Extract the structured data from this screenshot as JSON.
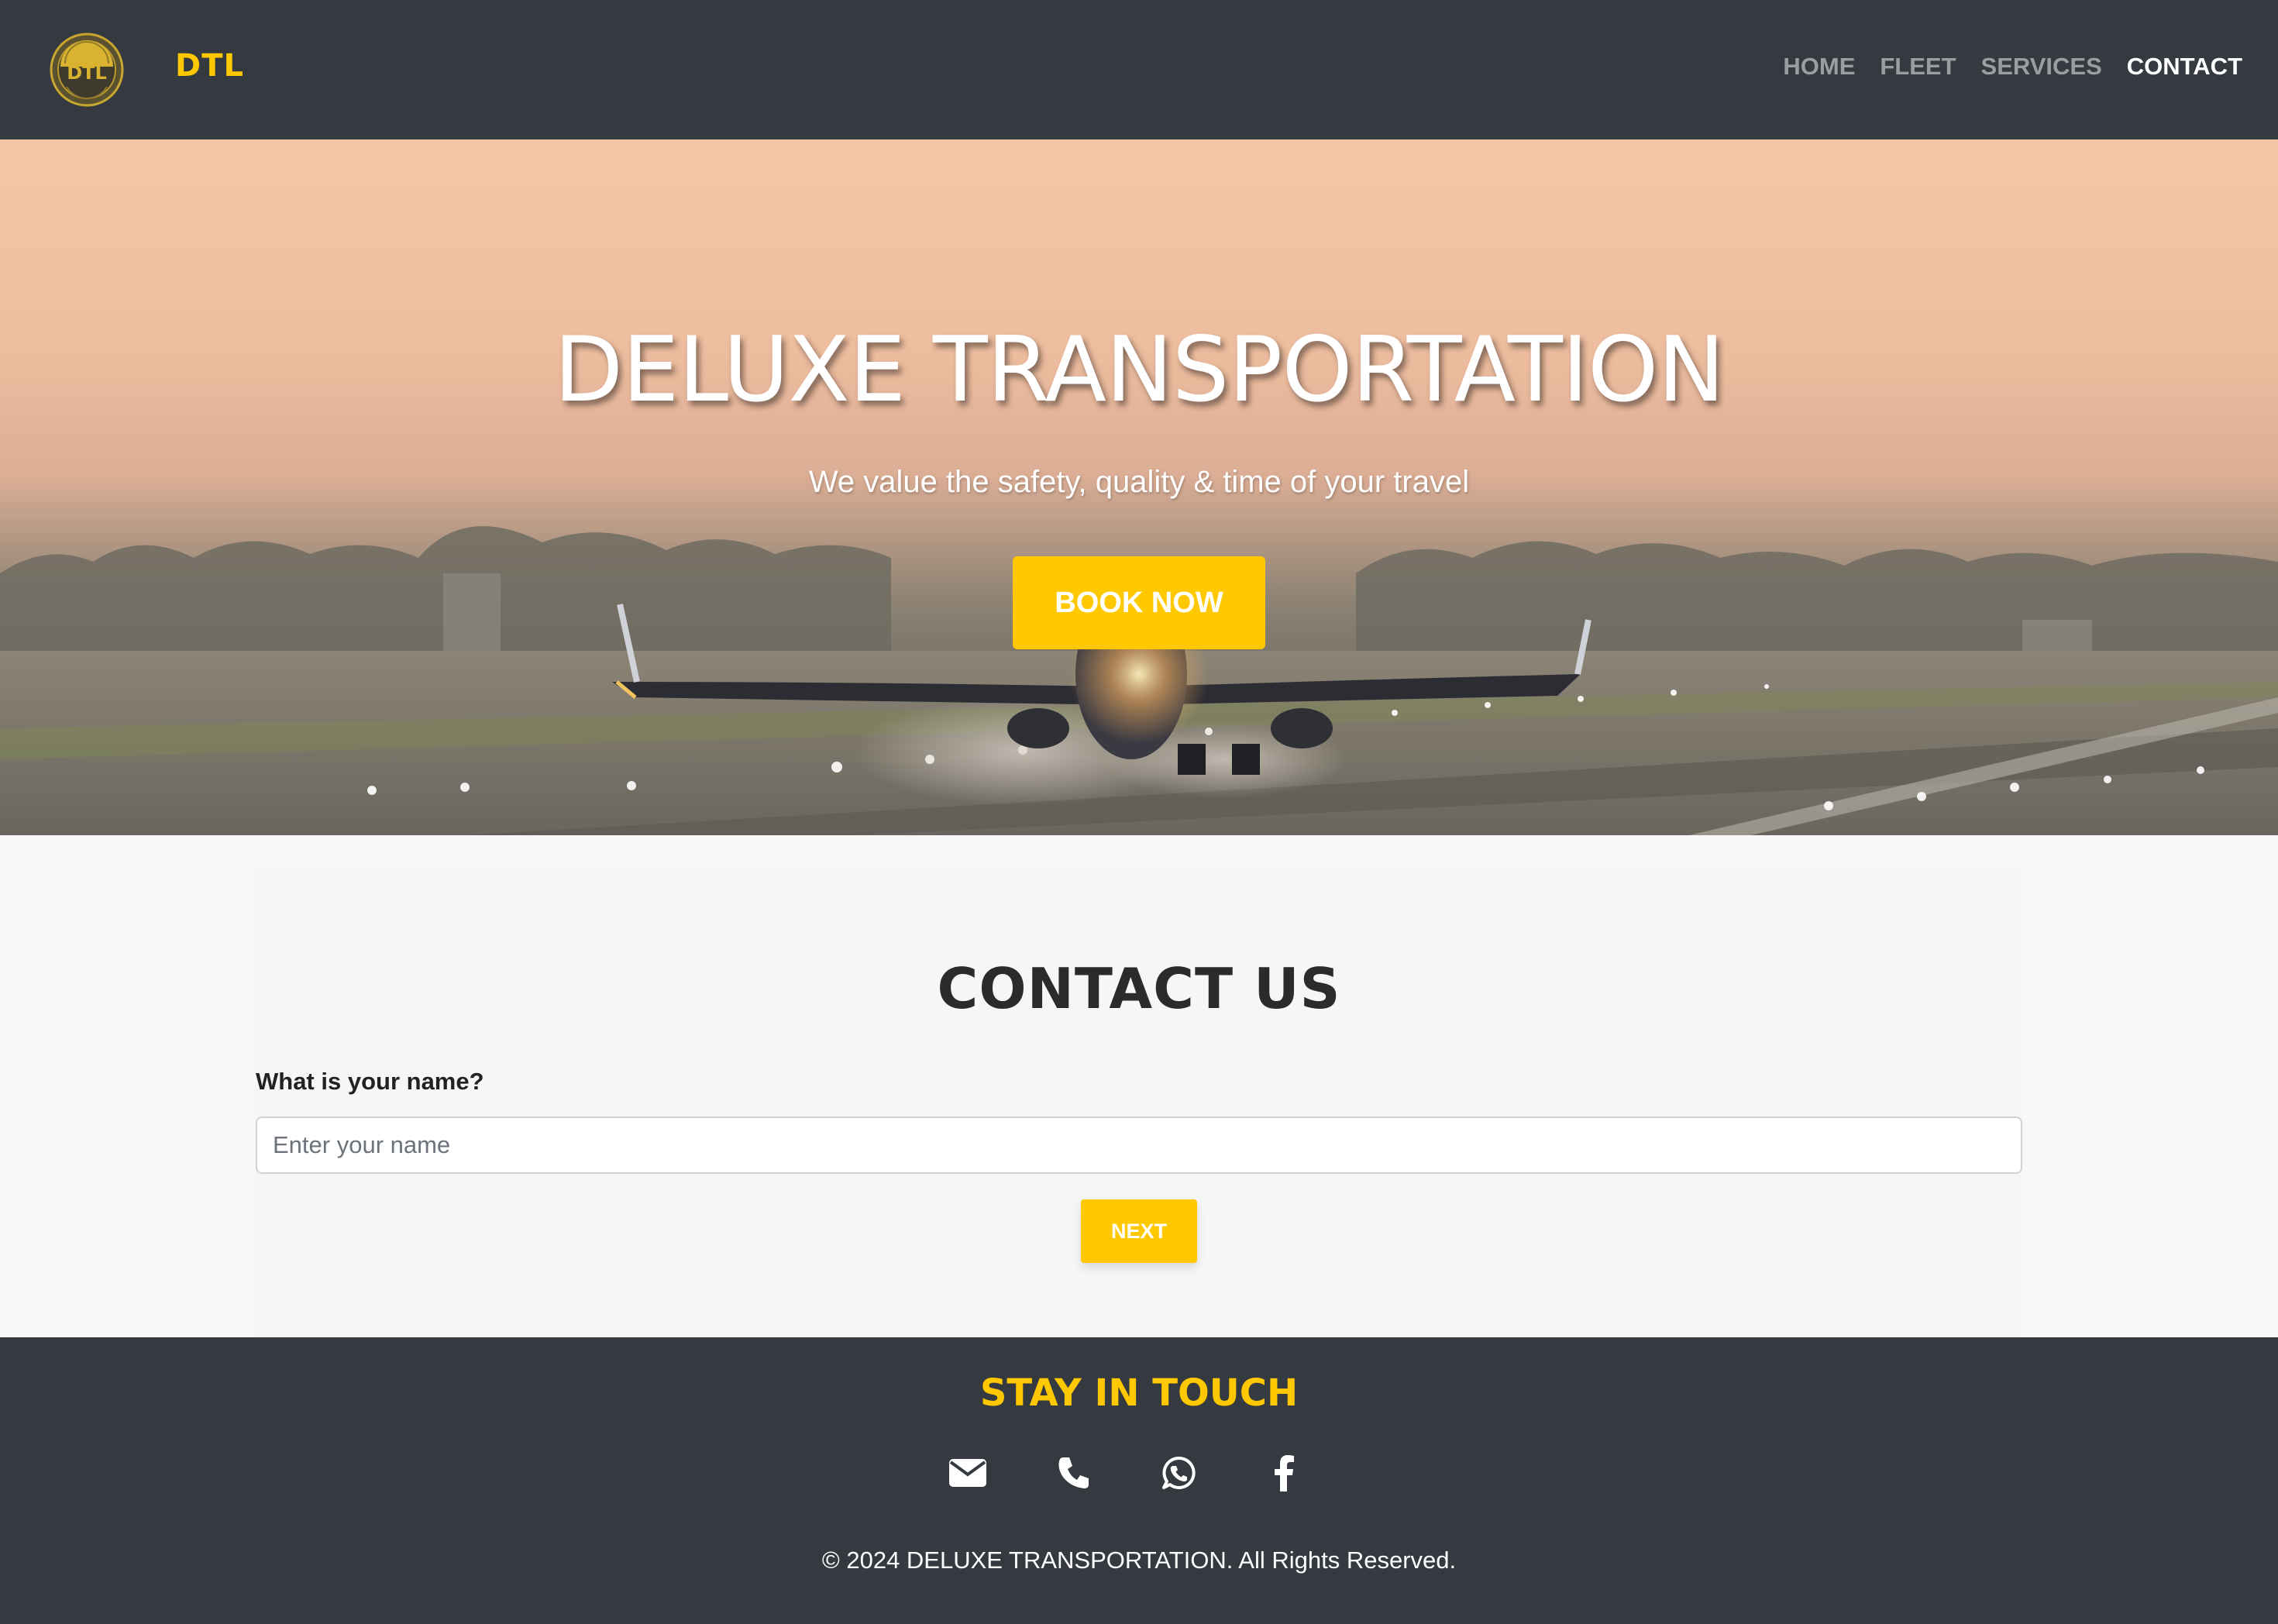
{
  "navbar": {
    "logo_text": "DTL",
    "brand": "DTL",
    "links": [
      {
        "label": "HOME"
      },
      {
        "label": "FLEET"
      },
      {
        "label": "SERVICES"
      },
      {
        "label": "CONTACT"
      }
    ],
    "active_link": "CONTACT"
  },
  "hero": {
    "title": "DELUXE TRANSPORTATION",
    "subtitle": "We value the safety, quality & time of your travel",
    "cta_label": "BOOK NOW"
  },
  "contact": {
    "title": "CONTACT US",
    "name_label": "What is your name?",
    "name_placeholder": "Enter your name",
    "name_value": "",
    "next_label": "NEXT"
  },
  "footer": {
    "title": "STAY IN TOUCH",
    "social_icons": [
      "envelope-icon",
      "phone-icon",
      "whatsapp-icon",
      "facebook-icon"
    ],
    "copyright": "© 2024 DELUXE TRANSPORTATION. All Rights Reserved."
  },
  "colors": {
    "accent": "#ffc800",
    "nav_bg": "#343a40",
    "nav_link": "#9a9ea3",
    "nav_link_active": "#ffffff",
    "page_bg": "#f8f8f8"
  }
}
